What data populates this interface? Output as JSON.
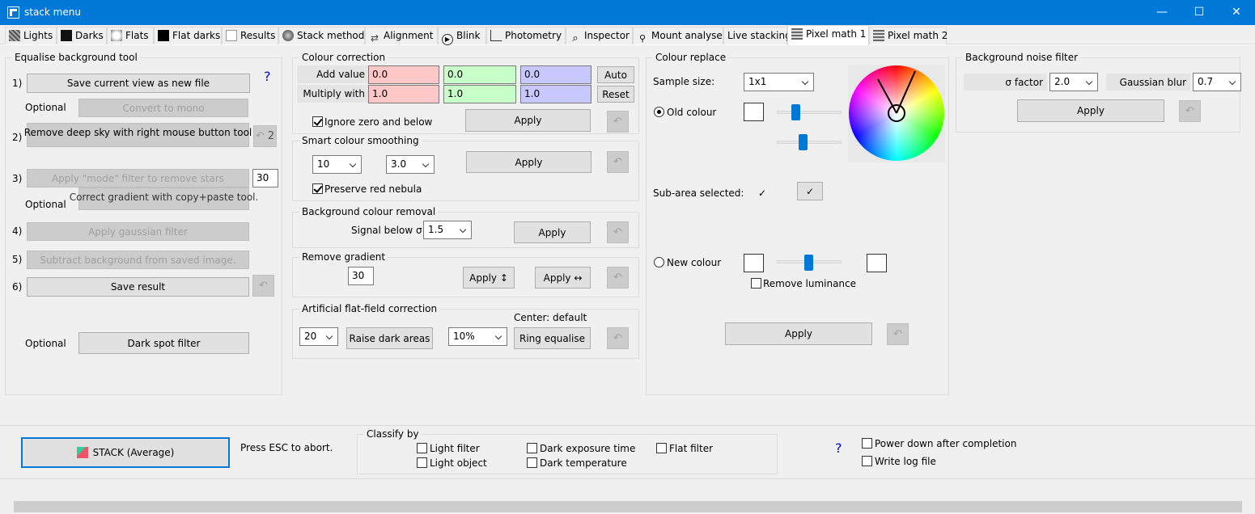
{
  "window": {
    "title": "stack menu",
    "min": "—",
    "max": "☐",
    "close": "✕"
  },
  "tabs": [
    "Lights",
    "Darks",
    "Flats",
    "Flat darks",
    "Results",
    "Stack method",
    "Alignment",
    "Blink",
    "Photometry",
    "Inspector",
    "Mount analyse",
    "Live stacking",
    "Pixel math 1",
    "Pixel math 2"
  ],
  "equalise": {
    "title": "Equalise background tool",
    "help": "?",
    "s1": "1)",
    "s2": "2)",
    "s3": "3)",
    "s4": "4)",
    "s5": "5)",
    "s6": "6)",
    "save_view": "Save current view as new file",
    "optional1": "Optional",
    "convert_mono": "Convert to mono",
    "remove_deep_sky": "Remove deep sky with right mouse button tool",
    "undo2": "2",
    "apply_mode": "Apply \"mode\" filter to remove stars",
    "mode_value": "30",
    "optional2": "Optional",
    "correct_gradient": "Correct gradient with copy+paste tool.",
    "apply_gaussian": "Apply gaussian filter",
    "subtract_bg": "Subtract background from saved image.",
    "save_result": "Save result",
    "optional3": "Optional",
    "dark_spot": "Dark spot filter"
  },
  "colour_correction": {
    "title": "Colour correction",
    "add_label": "Add value",
    "add_r": "0.0",
    "add_g": "0.0",
    "add_b": "0.0",
    "mult_label": "Multiply with",
    "mult_r": "1.0",
    "mult_g": "1.0",
    "mult_b": "1.0",
    "auto": "Auto",
    "reset": "Reset",
    "ignore_zero": "Ignore zero and below",
    "apply": "Apply"
  },
  "smart_smoothing": {
    "title": "Smart colour smoothing",
    "combo1": "10",
    "combo2": "3.0",
    "apply": "Apply",
    "preserve": "Preserve red nebula"
  },
  "bg_removal": {
    "title": "Background colour removal",
    "signal_label": "Signal below σ:",
    "signal": "1.5",
    "apply": "Apply"
  },
  "remove_gradient": {
    "title": "Remove gradient",
    "value": "30",
    "apply_v": "Apply ↕",
    "apply_h": "Apply ↔"
  },
  "flat_field": {
    "title": "Artificial flat-field correction",
    "combo1": "20",
    "raise": "Raise dark areas",
    "combo2": "10%",
    "center": "Center: default",
    "ring": "Ring equalise"
  },
  "colour_replace": {
    "title": "Colour replace",
    "sample_label": "Sample size:",
    "sample": "1x1",
    "old_colour": "Old colour",
    "sub_area": "Sub-area selected:",
    "sub_mark": "✓",
    "sub_btn": "✓",
    "new_colour": "New colour",
    "remove_lum": "Remove luminance",
    "apply": "Apply"
  },
  "noise_filter": {
    "title": "Background noise filter",
    "sigma_label": "σ factor",
    "sigma": "2.0",
    "blur_label": "Gaussian blur",
    "blur": "0.7",
    "apply": "Apply"
  },
  "bottom": {
    "stack_btn": "STACK  (Average)",
    "esc": "Press ESC to abort.",
    "classify": "Classify by",
    "light_filter": "Light filter",
    "light_object": "Light object",
    "dark_exposure": "Dark exposure time",
    "dark_temp": "Dark temperature",
    "flat_filter": "Flat filter",
    "help": "?",
    "power_down": "Power down after completion",
    "write_log": "Write log file"
  },
  "colors": {
    "accent": "#0078d7",
    "red_field": "#ffc8c8",
    "green_field": "#c8ffc8",
    "blue_field": "#c8c8ff"
  }
}
